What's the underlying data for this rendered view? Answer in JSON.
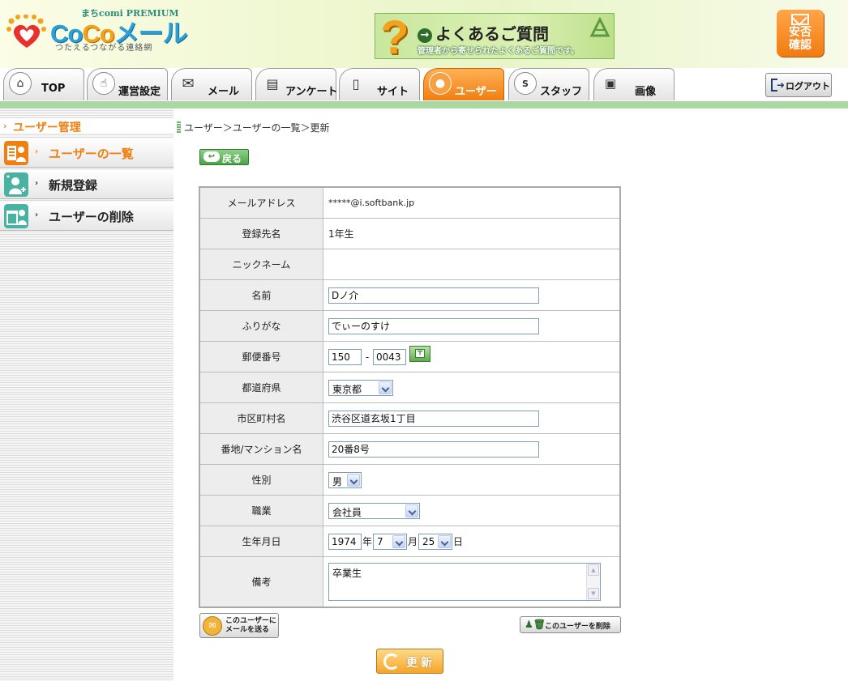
{
  "header": {
    "logo_premium": "まちcomi PREMIUM",
    "logo_brand_pre": "Co",
    "logo_brand_o": "Co",
    "logo_brand_post": "メール",
    "logo_tagline": "つたえるつながる連絡網",
    "faq_title": "よくあるご質問",
    "faq_subtitle": "管理者から寄せられたよくあるご質問です。",
    "safety_label_1": "安否",
    "safety_label_2": "確認"
  },
  "tabs": [
    {
      "label": "TOP",
      "icon": "house-icon"
    },
    {
      "label": "運営設定",
      "icon": "hand-icon"
    },
    {
      "label": "メール",
      "icon": "envelope-icon"
    },
    {
      "label": "アンケート",
      "icon": "document-icon"
    },
    {
      "label": "サイト",
      "icon": "mobile-phone-icon"
    },
    {
      "label": "ユーザー",
      "icon": "person-icon",
      "active": true
    },
    {
      "label": "スタッフ",
      "icon": "staff-icon"
    },
    {
      "label": "画像",
      "icon": "camera-icon"
    }
  ],
  "logout_label": "ログアウト",
  "sidebar": {
    "title": "ユーザー管理",
    "items": [
      {
        "label": "ユーザーの一覧",
        "active": true
      },
      {
        "label": "新規登録"
      },
      {
        "label": "ユーザーの削除"
      }
    ]
  },
  "breadcrumb": "ユーザー＞ユーザーの一覧＞更新",
  "back_label": "戻る",
  "form": {
    "email_label": "メールアドレス",
    "email_value": "*****@i.softbank.jp",
    "group_label": "登録先名",
    "group_value": "1年生",
    "nickname_label": "ニックネーム",
    "nickname_value": "",
    "name_label": "名前",
    "name_value": "Dノ介",
    "furigana_label": "ふりがな",
    "furigana_value": "でぃーのすけ",
    "zip_label": "郵便番号",
    "zip1": "150",
    "zip_sep": "-",
    "zip2": "0043",
    "pref_label": "都道府県",
    "pref_value": "東京都",
    "city_label": "市区町村名",
    "city_value": "渋谷区道玄坂1丁目",
    "address_label": "番地/マンション名",
    "address_value": "20番8号",
    "gender_label": "性別",
    "gender_value": "男",
    "job_label": "職業",
    "job_value": "会社員",
    "birth_label": "生年月日",
    "birth_year": "1974",
    "year_unit": "年",
    "birth_month": "7",
    "month_unit": "月",
    "birth_day": "25",
    "day_unit": "日",
    "note_label": "備考",
    "note_value": "卒業生"
  },
  "mail_user_label": "このユーザーにメールを送る",
  "delete_user_label": "このユーザーを削除",
  "update_label": "更新"
}
